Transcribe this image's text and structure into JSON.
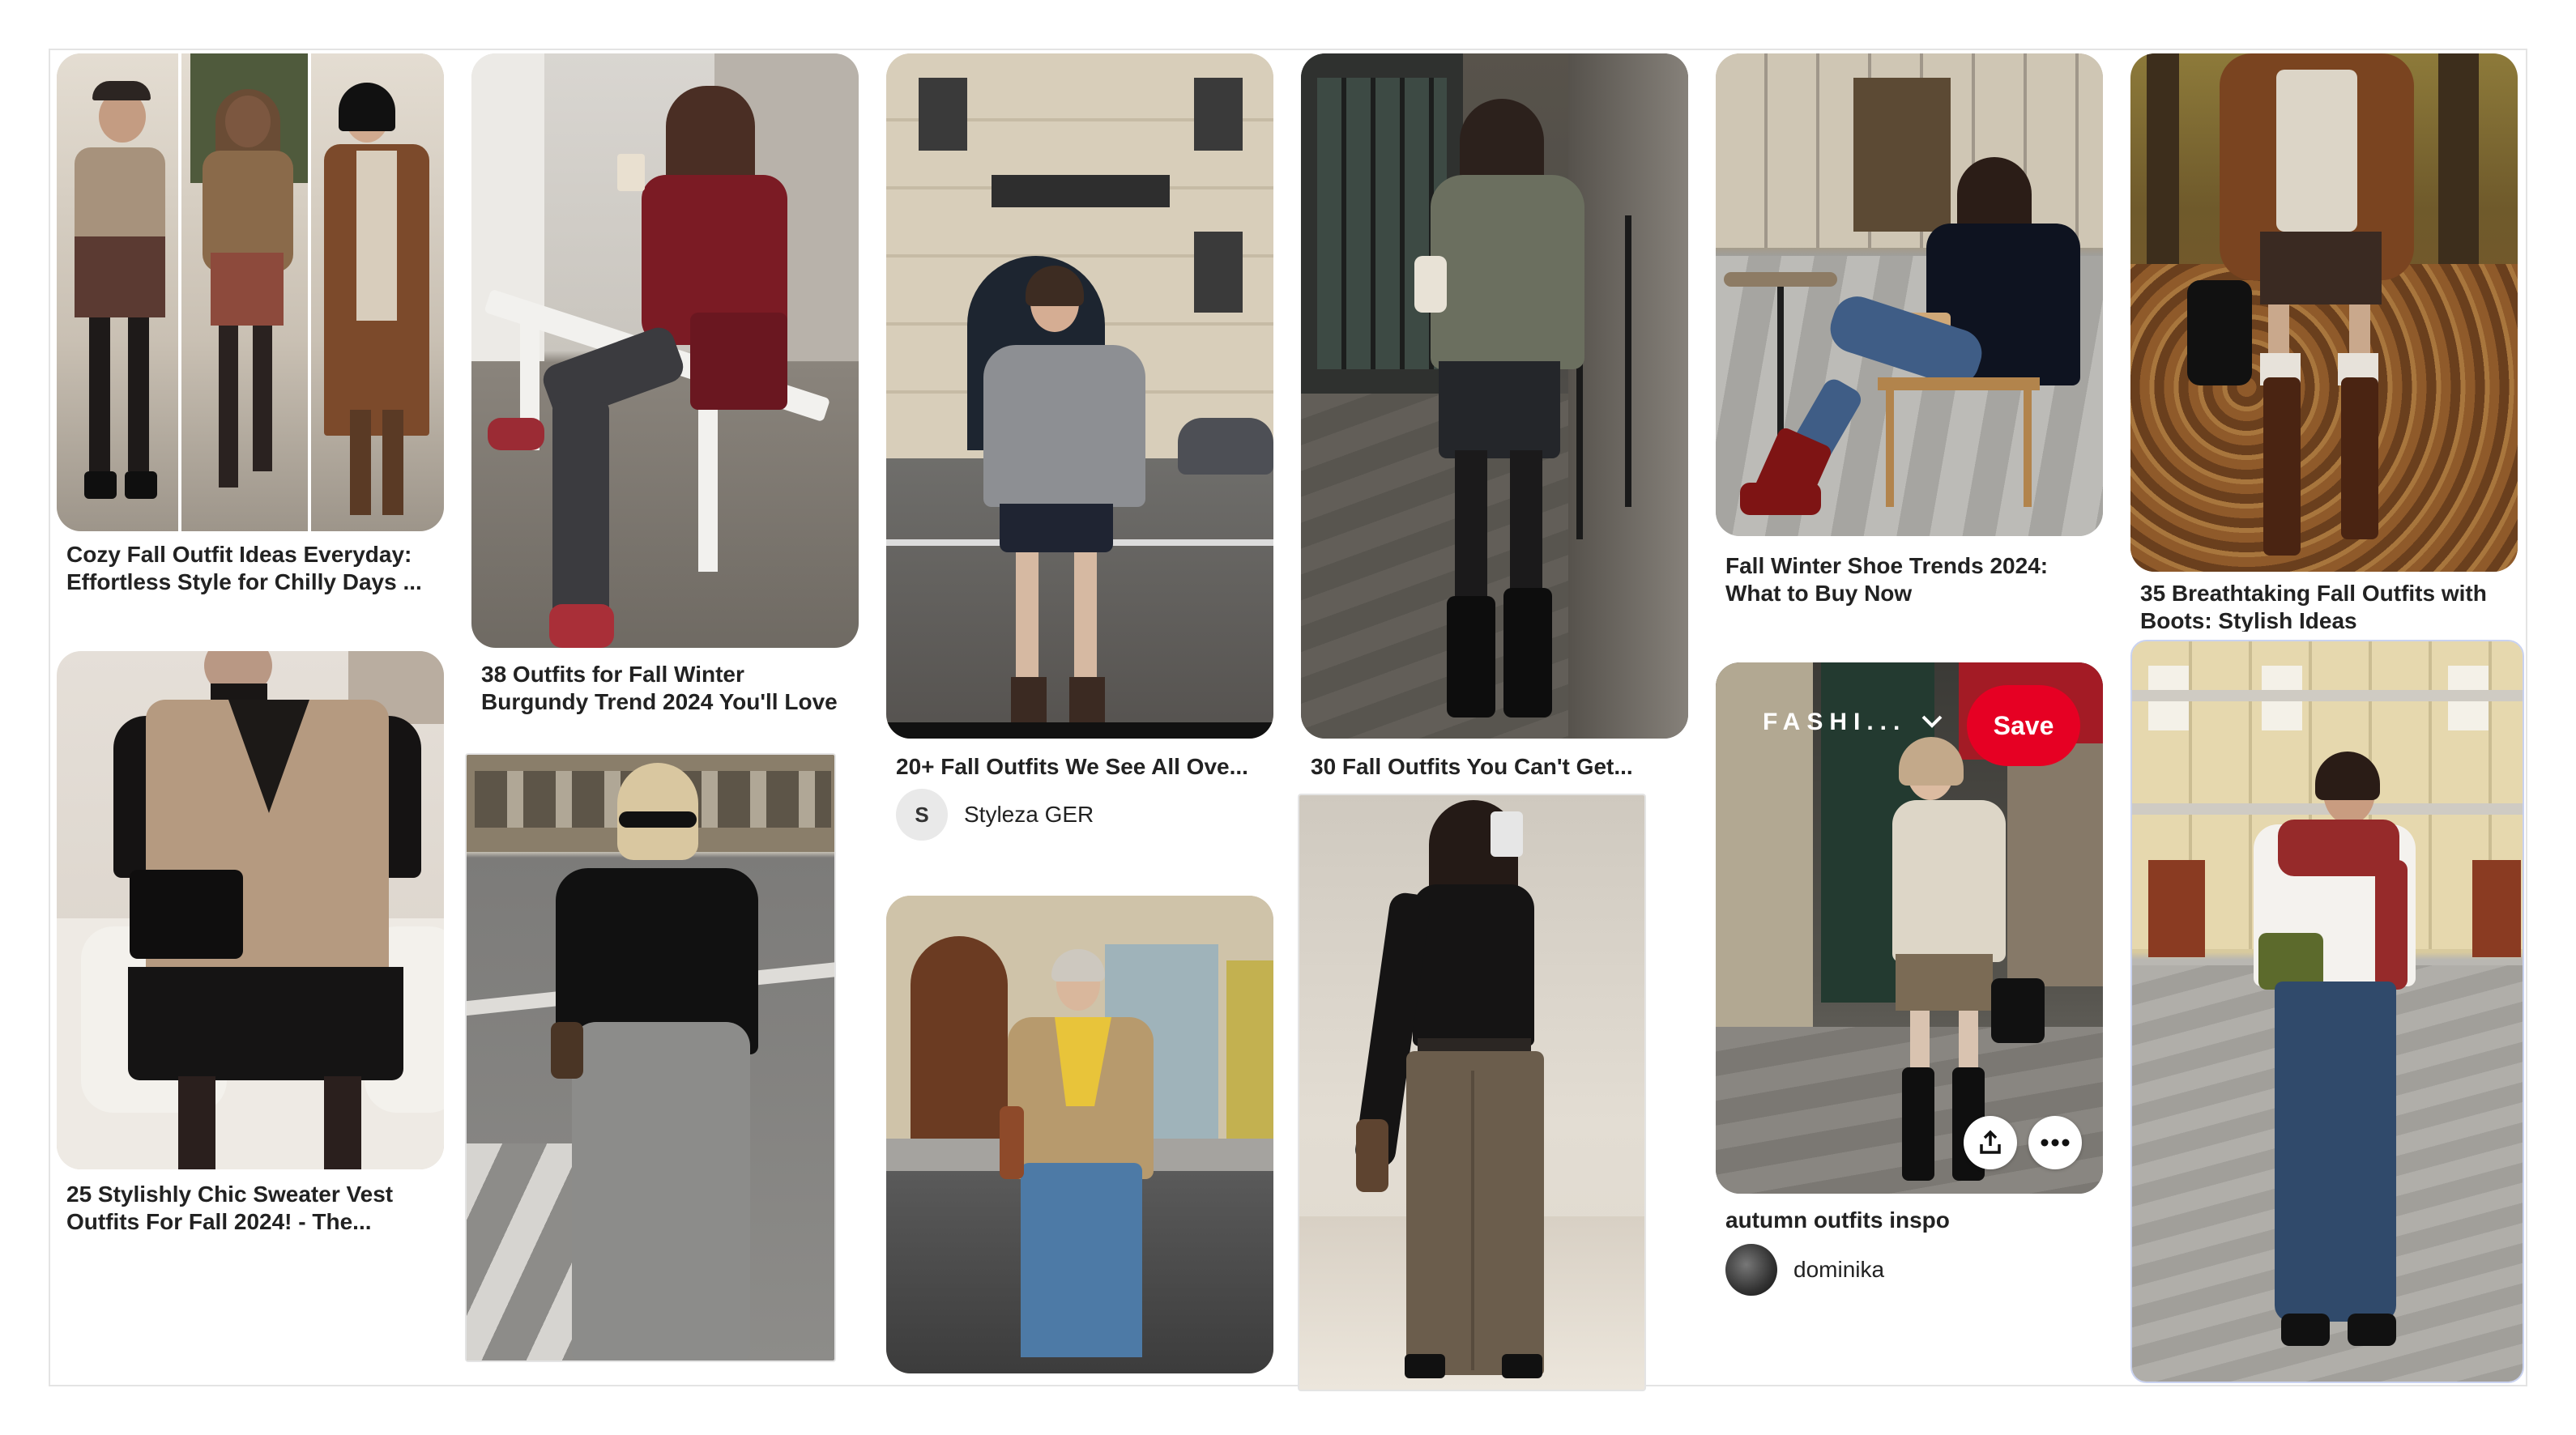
{
  "pins": [
    {
      "caption": "Cozy Fall Outfit Ideas Everyday:\nEffortless Style for Chilly Days ..."
    },
    {
      "caption": "38 Outfits for Fall Winter\nBurgundy Trend 2024 You'll Love"
    },
    {
      "caption": "25 Stylishly Chic Sweater Vest\nOutfits For Fall 2024! - The..."
    },
    {
      "caption": "20+ Fall Outfits We See All Ove...",
      "author": {
        "initial": "S",
        "name": "Styleza GER"
      }
    },
    {
      "caption": "30 Fall Outfits You Can't Get..."
    },
    {
      "caption": "Fall Winter Shoe Trends 2024:\nWhat to Buy Now"
    },
    {
      "caption": "autumn outfits inspo",
      "author": {
        "name": "dominika"
      },
      "board_picker": "FASHI...",
      "save_label": "Save",
      "hover_icons": [
        "share-icon",
        "more-icon"
      ]
    },
    {
      "caption": "35 Breathtaking Fall Outfits with\nBoots: Stylish Ideas"
    }
  ],
  "colors": {
    "save": "#e60023",
    "caption": "#222222",
    "avatar_bg": "#e9e9e9"
  }
}
